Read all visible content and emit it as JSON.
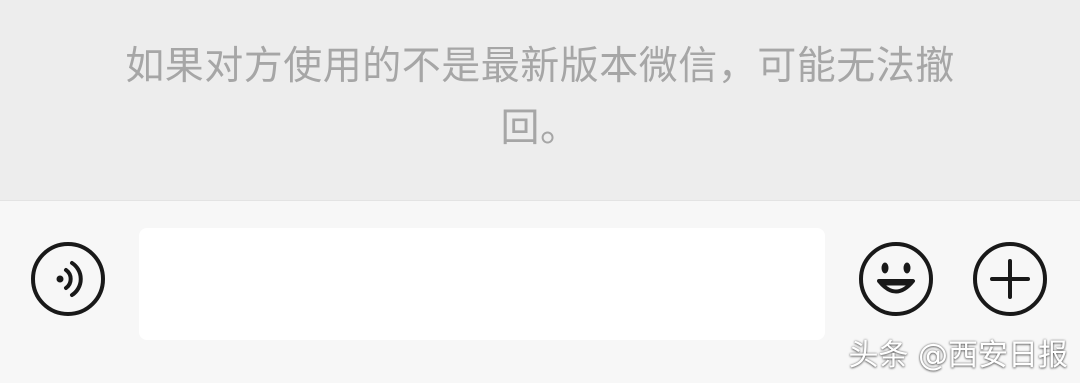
{
  "system_message": {
    "text": "如果对方使用的不是最新版本微信，可能无法撤回。"
  },
  "input_bar": {
    "voice_icon": "voice-icon",
    "text_value": "",
    "emoji_icon": "smiley-icon",
    "plus_icon": "plus-icon"
  },
  "watermark": {
    "text": "头条 @西安日报"
  },
  "colors": {
    "system_background": "#ededed",
    "system_text": "#a6a6a6",
    "input_bar_background": "#f7f7f7",
    "input_field_background": "#ffffff",
    "icon_stroke": "#191919"
  }
}
